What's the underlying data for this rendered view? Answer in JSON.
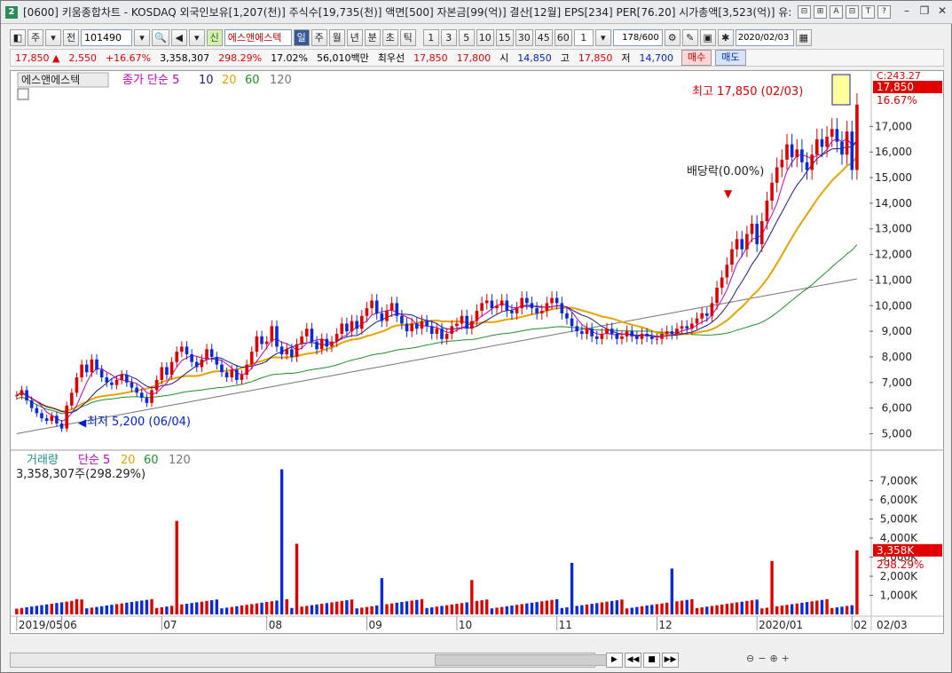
{
  "window": {
    "app_badge": "2",
    "title": "[0600] 키움종합차트 - KOSDAQ 외국인보유[1,207(천)] 주식수[19,735(천)] 액면[500] 자본금[99(억)] 결산[12월] EPS[234] PER[76.20] 시가총액[3,523(억)] 유:",
    "title_icons": [
      "⊟",
      "⊞",
      "A",
      "⊟",
      "T",
      "?"
    ],
    "window_buttons": [
      "–",
      "❐",
      "✕"
    ]
  },
  "toolbar": {
    "layout_btn": "◧",
    "mode_label": "주",
    "prev_label": "전",
    "code_value": "101490",
    "new_badge": "신",
    "stock_name": "에스앤에스텍",
    "periods": [
      "일",
      "주",
      "월",
      "년",
      "분",
      "초",
      "틱"
    ],
    "active_period": "일",
    "intervals": [
      "1",
      "3",
      "5",
      "10",
      "15",
      "30",
      "45",
      "60"
    ],
    "interval_select": "1",
    "count_value": "178/600",
    "date_value": "2020/02/03"
  },
  "quote": {
    "price": "17,850 ▲",
    "change": "2,550",
    "change_pct": "+16.67%",
    "volume": "3,358,307",
    "volume_pct": "298.29%",
    "turnover": "17.02%",
    "amount": "56,010백만",
    "best_label": "최우선",
    "best_ask": "17,850",
    "best_bid": "17,800",
    "open_label": "시",
    "open": "14,850",
    "high_label": "고",
    "high": "17,850",
    "low_label": "저",
    "low": "14,700",
    "buy_label": "매수",
    "sell_label": "매도"
  },
  "colors": {
    "up": "#e00000",
    "down": "#0a2ad8",
    "ma5": "#c000c0",
    "ma10": "#1a1a8a",
    "ma20": "#e6a400",
    "ma60": "#1f8f2a",
    "ma120": "#777777"
  },
  "chart_data": [
    {
      "type": "candlestick",
      "title": "에스앤에스텍",
      "legend": [
        "종가 단순 5",
        "10",
        "20",
        "60",
        "120"
      ],
      "y_ticks": [
        "17,000",
        "16,000",
        "15,000",
        "14,000",
        "13,000",
        "12,000",
        "11,000",
        "10,000",
        "9,000",
        "8,000",
        "7,000",
        "6,000",
        "5,000"
      ],
      "y_ticks_values": [
        17000,
        16000,
        15000,
        14000,
        13000,
        12000,
        11000,
        10000,
        9000,
        8000,
        7000,
        6000,
        5000
      ],
      "ylim": [
        4600,
        18400
      ],
      "current_price_label": "17,850",
      "current_pct_label": "16.67%",
      "hidden_top_label": "C:243.27",
      "annotations": {
        "high": "최고 17,850 (02/03)",
        "low": "최저 5,200 (06/04)",
        "dividend": "배당락(0.00%)"
      },
      "x_labels": [
        "2019/05",
        "06",
        "07",
        "08",
        "09",
        "10",
        "11",
        "12",
        "2020/01",
        "02"
      ],
      "x_label_months": [
        0,
        1,
        2,
        3,
        4,
        5,
        6,
        7,
        8,
        9
      ],
      "series_close_by_month": [
        {
          "month": "2019/05",
          "close": [
            6500,
            6700,
            6300,
            6000,
            5800,
            5600,
            5500,
            5700,
            5400
          ]
        },
        {
          "month": "06",
          "close": [
            5200,
            6100,
            6600,
            7200,
            7700,
            7400,
            7900,
            7500,
            7200,
            7000,
            6900,
            7100,
            7300,
            7000,
            6800,
            6600,
            6400,
            6200,
            6700,
            7100
          ]
        },
        {
          "month": "07",
          "close": [
            7600,
            7300,
            7800,
            8200,
            8400,
            8100,
            7800,
            7600,
            7900,
            8300,
            8000,
            7700,
            7400,
            7200,
            7500,
            7100,
            7300,
            7700,
            8200,
            8800,
            8500
          ]
        },
        {
          "month": "08",
          "close": [
            8600,
            9200,
            8400,
            8100,
            8300,
            8000,
            8500,
            8800,
            9100,
            8600,
            8300,
            8700,
            8400,
            8600,
            8900,
            9300,
            9000,
            9400,
            9100,
            9600
          ]
        },
        {
          "month": "09",
          "close": [
            9900,
            10200,
            9700,
            9400,
            9800,
            10100,
            9600,
            9300,
            9000,
            9300,
            9100,
            9400,
            9200,
            8900,
            9100,
            8700,
            8900,
            9200
          ]
        },
        {
          "month": "10",
          "close": [
            9300,
            9600,
            9100,
            9400,
            9800,
            10100,
            10200,
            9900,
            10000,
            10200,
            9800,
            9700,
            9900,
            10300,
            10100,
            9900,
            9700,
            9800,
            10100,
            10300
          ]
        },
        {
          "month": "11",
          "close": [
            10100,
            9700,
            9500,
            9200,
            9000,
            8900,
            9100,
            8800,
            8700,
            8900,
            9100,
            8900,
            8700,
            8800,
            9000,
            8800,
            8700,
            8900,
            8800,
            8700
          ]
        },
        {
          "month": "12",
          "close": [
            8700,
            8900,
            9000,
            8900,
            9100,
            9200,
            9100,
            9300,
            9500,
            9700,
            9600,
            10100,
            10700,
            11100,
            11600,
            12200,
            12600,
            12200,
            12800,
            13200
          ]
        },
        {
          "month": "2020/01",
          "close": [
            12400,
            13300,
            14100,
            14800,
            15400,
            15700,
            16300,
            15800,
            16100,
            15600,
            15300,
            15900,
            16500,
            16200,
            16600,
            16900,
            16400,
            15900,
            16800
          ]
        },
        {
          "month": "02",
          "close": [
            15300,
            17850
          ]
        }
      ]
    },
    {
      "type": "bar",
      "title": "거래량",
      "legend": [
        "단순 5",
        "20",
        "60",
        "120"
      ],
      "current_label": "3,358,307주(298.29%)",
      "y_ticks": [
        "7,000K",
        "6,000K",
        "5,000K",
        "4,000K",
        "3,000K",
        "2,000K",
        "1,000K"
      ],
      "y_ticks_values": [
        7000,
        6000,
        5000,
        4000,
        3000,
        2000,
        1000
      ],
      "ylim": [
        0,
        8000
      ],
      "current_value_label": "3,358K",
      "current_pct_label": "298.29%",
      "peaks_thousands": [
        {
          "month": "06",
          "value": 800
        },
        {
          "month": "07",
          "value": 4900
        },
        {
          "month": "08",
          "value": 7600
        },
        {
          "month": "08",
          "value": 3700
        },
        {
          "month": "09",
          "value": 1900
        },
        {
          "month": "10",
          "value": 1800
        },
        {
          "month": "11",
          "value": 2700
        },
        {
          "month": "12",
          "value": 2400
        },
        {
          "month": "2020/01",
          "value": 2800
        },
        {
          "month": "02",
          "value": 3358
        }
      ]
    }
  ],
  "footer": {
    "last_date": "02/03"
  }
}
